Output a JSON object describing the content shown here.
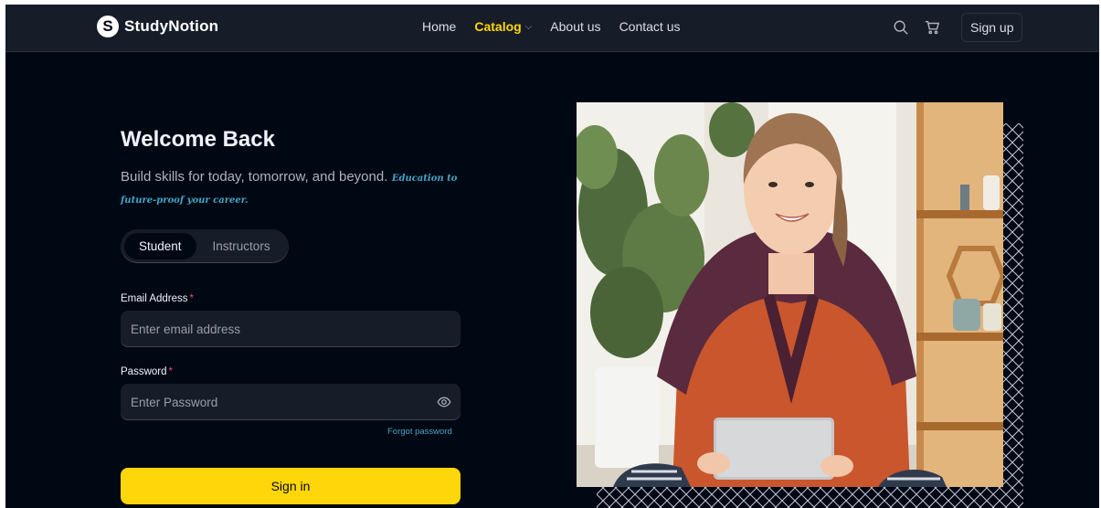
{
  "brand": {
    "name": "StudyNotion",
    "mark": "S"
  },
  "nav": {
    "links": [
      {
        "label": "Home"
      },
      {
        "label": "Catalog"
      },
      {
        "label": "About us"
      },
      {
        "label": "Contact us"
      }
    ],
    "signup_label": "Sign up"
  },
  "login": {
    "title": "Welcome Back",
    "subtitle": "Build skills for today, tomorrow, and beyond.",
    "subtitle_accent": "Education to future-proof your career.",
    "tabs": [
      {
        "label": "Student"
      },
      {
        "label": "Instructors"
      }
    ],
    "email": {
      "label": "Email Address",
      "required_mark": "*",
      "placeholder": "Enter email address",
      "value": ""
    },
    "password": {
      "label": "Password",
      "required_mark": "*",
      "placeholder": "Enter Password",
      "value": ""
    },
    "forgot_label": "Forgot password",
    "submit_label": "Sign in"
  },
  "icons": [
    "search-icon",
    "cart-icon",
    "eye-icon",
    "chevron-down-icon"
  ],
  "colors": {
    "background": "#000814",
    "navbar": "#161d29",
    "accent_yellow": "#ffd60a",
    "accent_blue": "#47a5c5",
    "required_red": "#ef476f"
  }
}
